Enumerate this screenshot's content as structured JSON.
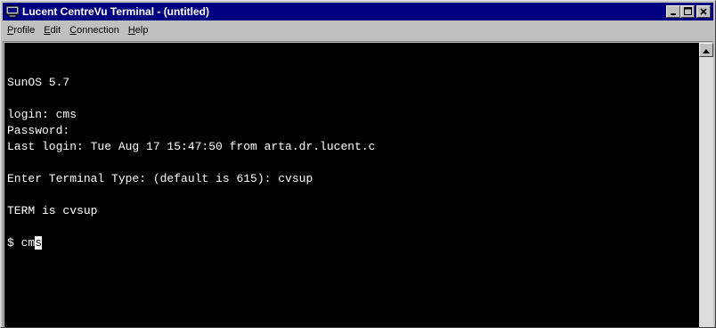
{
  "window": {
    "title": "Lucent CentreVu Terminal - (untitled)"
  },
  "icons": {
    "app": "terminal-app-icon",
    "minimize": "minimize-icon",
    "maximize": "maximize-icon",
    "close": "close-icon",
    "scroll_up": "arrow-up-icon"
  },
  "menu": [
    {
      "underline": "P",
      "rest": "rofile"
    },
    {
      "underline": "E",
      "rest": "dit"
    },
    {
      "underline": "C",
      "rest": "onnection"
    },
    {
      "underline": "H",
      "rest": "elp"
    }
  ],
  "terminal": {
    "lines": [
      "",
      "",
      "SunOS 5.7",
      "",
      "login: cms",
      "Password:",
      "Last login: Tue Aug 17 15:47:50 from arta.dr.lucent.c",
      "",
      "Enter Terminal Type: (default is 615): cvsup",
      "",
      "TERM is cvsup",
      "",
      "$ cm"
    ],
    "cursor_char": "s"
  },
  "colors": {
    "titlebar": "#000080",
    "terminal_bg": "#000000",
    "terminal_fg": "#ffffff",
    "chrome": "#c0c0c0"
  }
}
